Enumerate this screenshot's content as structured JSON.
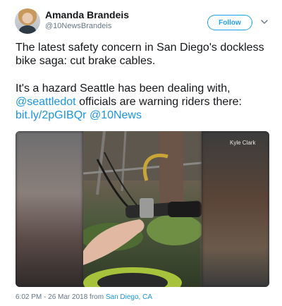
{
  "author": {
    "display_name": "Amanda Brandeis",
    "screen_name": "@10NewsBrandeis"
  },
  "follow_label": "Follow",
  "tweet": {
    "line1": "The latest safety concern in San Diego's dockless bike saga: cut brake cables.",
    "line2_text": "It's a hazard Seattle has been dealing with, ",
    "mention1": "@seattledot",
    "line2_text_b": " officials are warning riders there: ",
    "link": "bit.ly/2pGIBQr",
    "mention2": "@10News"
  },
  "media": {
    "watermark": "Kyle Clark"
  },
  "footer": {
    "time": "6:02 PM - 26 Mar 2018 from ",
    "place": "San Diego, CA"
  },
  "colors": {
    "link": "#1b95e0",
    "follow_border": "#1da1f2",
    "muted": "#657786"
  },
  "icons": [
    "chevron-down-icon"
  ]
}
